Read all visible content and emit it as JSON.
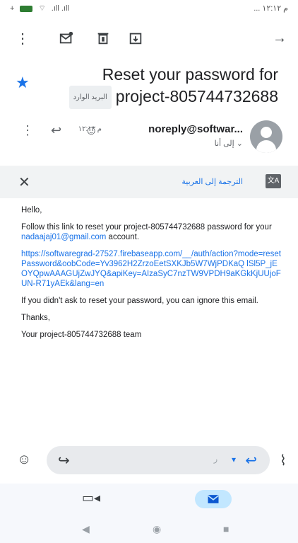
{
  "status_bar": {
    "left_text": "+",
    "right_text": "... م ۱۲:۱۲"
  },
  "subject": {
    "line1": "Reset your password for",
    "label": "البريد الوارد",
    "line2": "project-805744732688"
  },
  "sender": {
    "name": "noreply@softwar...",
    "time": "م ١٢:١٣",
    "to": "إلى أنا ⌄",
    "avatar_icon": "person-icon"
  },
  "translate": {
    "link": "الترجمة إلى العربية"
  },
  "email_body": {
    "greeting": "Hello,",
    "para1_prefix": "Follow this link to reset your project-805744732688 password for your ",
    "email": "nadaajaj01@gmail.com",
    "para1_suffix": " account.",
    "url": "https://softwaregrad-27527.firebaseapp.com/__/auth/action?mode=resetPassword&oobCode=Yv3962H2ZrzoEetSXKJb5W7WjPDKaQ lSl5P_jEOYQpwAAAGUjZwJYQ&apiKey=AIzaSyC7nzTW9VPDH9aKGkKjUUjoFUN-R71yAEk&lang=en",
    "para2": "If you didn't ask to reset your password, you can ignore this email.",
    "thanks": "Thanks,",
    "signature": "Your project-805744732688 team"
  },
  "reply_bar": {
    "reply_all_hint": "ر"
  },
  "icons": {
    "toolbar": [
      "more-vert-icon",
      "mark-unread-icon",
      "delete-icon",
      "archive-icon",
      "forward-arrow-icon"
    ],
    "accent": "#1a73e8"
  }
}
